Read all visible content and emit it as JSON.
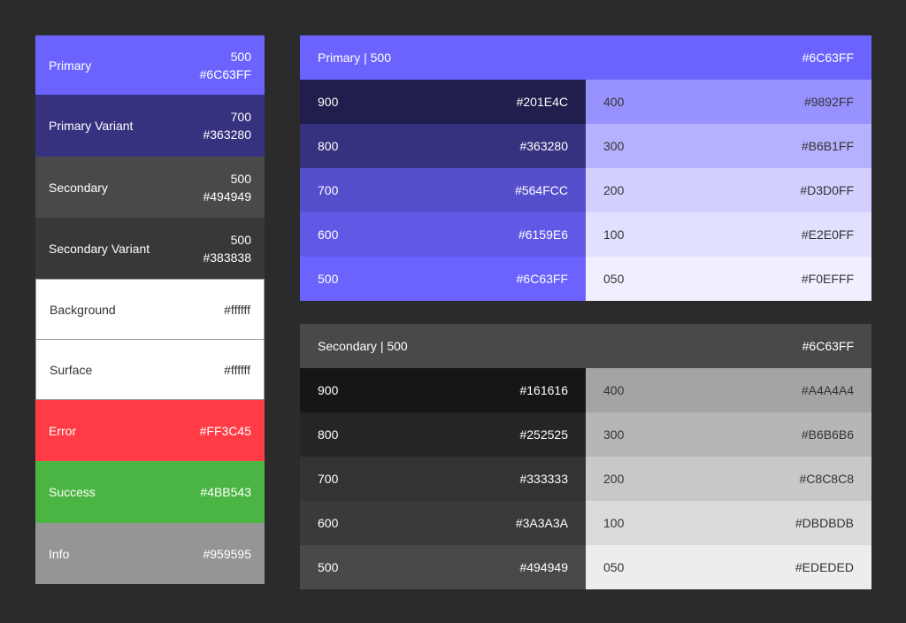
{
  "swatches": [
    {
      "name": "Primary",
      "shade": "500",
      "hex": "#6C63FF",
      "bg": "#6C63FF",
      "fg": "#ffffff",
      "h": 67
    },
    {
      "name": "Primary Variant",
      "shade": "700",
      "hex": "#363280",
      "bg": "#363280",
      "fg": "#ffffff",
      "h": 70
    },
    {
      "name": "Secondary",
      "shade": "500",
      "hex": "#494949",
      "bg": "#494949",
      "fg": "#ffffff",
      "h": 69
    },
    {
      "name": "Secondary Variant",
      "shade": "500",
      "hex": "#383838",
      "bg": "#383838",
      "fg": "#ffffff",
      "h": 69
    },
    {
      "name": "Background",
      "shade": "",
      "hex": "#ffffff",
      "bg": "#ffffff",
      "fg": "#333333",
      "h": 69,
      "outlined": true
    },
    {
      "name": "Surface",
      "shade": "",
      "hex": "#ffffff",
      "bg": "#ffffff",
      "fg": "#333333",
      "h": 68,
      "outlined": true
    },
    {
      "name": "Error",
      "shade": "",
      "hex": "#FF3C45",
      "bg": "#FF3C45",
      "fg": "#ffffff",
      "h": 69
    },
    {
      "name": "Success",
      "shade": "",
      "hex": "#4BB543",
      "bg": "#4BB543",
      "fg": "#ffffff",
      "h": 70
    },
    {
      "name": "Info",
      "shade": "",
      "hex": "#959595",
      "bg": "#959595",
      "fg": "#ffffff",
      "h": 69
    }
  ],
  "primary_panel": {
    "title": "Primary | 500",
    "hex": "#6C63FF",
    "header_bg": "#6C63FF",
    "left": [
      {
        "label": "900",
        "hex": "#201E4C",
        "bg": "#201E4C",
        "dark": false
      },
      {
        "label": "800",
        "hex": "#363280",
        "bg": "#363280",
        "dark": false
      },
      {
        "label": "700",
        "hex": "#564FCC",
        "bg": "#564FCC",
        "dark": false
      },
      {
        "label": "600",
        "hex": "#6159E6",
        "bg": "#6159E6",
        "dark": false
      },
      {
        "label": "500",
        "hex": "#6C63FF",
        "bg": "#6C63FF",
        "dark": false
      }
    ],
    "right": [
      {
        "label": "400",
        "hex": "#9892FF",
        "bg": "#9892FF",
        "dark": true
      },
      {
        "label": "300",
        "hex": "#B6B1FF",
        "bg": "#B6B1FF",
        "dark": true
      },
      {
        "label": "200",
        "hex": "#D3D0FF",
        "bg": "#D3D0FF",
        "dark": true
      },
      {
        "label": "100",
        "hex": "#E2E0FF",
        "bg": "#E2E0FF",
        "dark": true
      },
      {
        "label": "050",
        "hex": "#F0EFFF",
        "bg": "#F0EFFF",
        "dark": true
      }
    ]
  },
  "secondary_panel": {
    "title": "Secondary | 500",
    "hex": "#6C63FF",
    "header_bg": "#494949",
    "left": [
      {
        "label": "900",
        "hex": "#161616",
        "bg": "#161616",
        "dark": false
      },
      {
        "label": "800",
        "hex": "#252525",
        "bg": "#252525",
        "dark": false
      },
      {
        "label": "700",
        "hex": "#333333",
        "bg": "#333333",
        "dark": false
      },
      {
        "label": "600",
        "hex": "#3A3A3A",
        "bg": "#3A3A3A",
        "dark": false
      },
      {
        "label": "500",
        "hex": "#494949",
        "bg": "#494949",
        "dark": false
      }
    ],
    "right": [
      {
        "label": "400",
        "hex": "#A4A4A4",
        "bg": "#A4A4A4",
        "dark": true
      },
      {
        "label": "300",
        "hex": "#B6B6B6",
        "bg": "#B6B6B6",
        "dark": true
      },
      {
        "label": "200",
        "hex": "#C8C8C8",
        "bg": "#C8C8C8",
        "dark": true
      },
      {
        "label": "100",
        "hex": "#DBDBDB",
        "bg": "#DBDBDB",
        "dark": true
      },
      {
        "label": "050",
        "hex": "#EDEDED",
        "bg": "#EDEDED",
        "dark": true
      }
    ]
  }
}
